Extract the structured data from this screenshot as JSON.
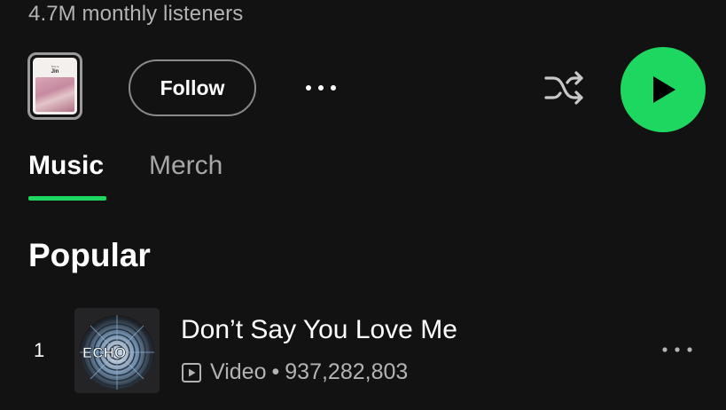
{
  "artist": {
    "monthly_listeners": "4.7M monthly listeners"
  },
  "actions": {
    "preview_card": {
      "label_top": "This is",
      "label_name": "Jin"
    },
    "follow_label": "Follow",
    "more_icon": "more-horizontal-icon",
    "shuffle_icon": "shuffle-icon",
    "play_icon": "play-icon",
    "accent_color": "#1ed760"
  },
  "tabs": [
    {
      "label": "Music",
      "active": true
    },
    {
      "label": "Merch",
      "active": false
    }
  ],
  "popular": {
    "title": "Popular",
    "tracks": [
      {
        "rank": "1",
        "title": "Don’t Say You Love Me",
        "type": "Video",
        "separator": "•",
        "plays": "937,282,803",
        "art_text": "ECHO"
      }
    ]
  }
}
